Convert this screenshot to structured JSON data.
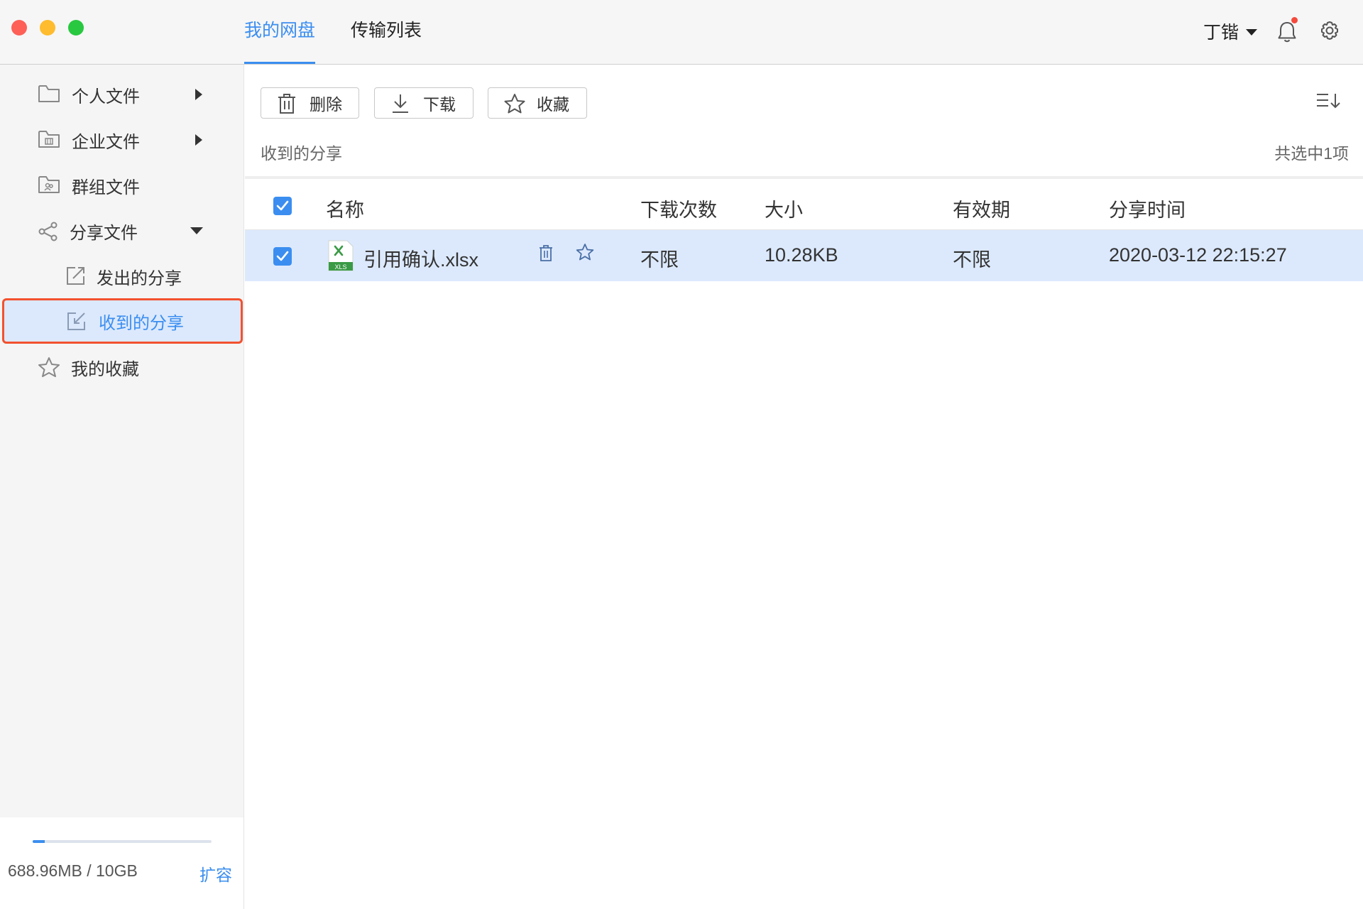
{
  "titlebar": {
    "tabs": [
      {
        "label": "我的网盘",
        "active": true
      },
      {
        "label": "传输列表",
        "active": false
      }
    ],
    "user_name": "丁锴",
    "notification_dot": true,
    "accent_color": "#3b8ef0"
  },
  "sidebar": {
    "items": [
      {
        "label": "个人文件",
        "icon": "folder-icon"
      },
      {
        "label": "企业文件",
        "icon": "enterprise-folder-icon"
      },
      {
        "label": "群组文件",
        "icon": "group-folder-icon"
      },
      {
        "label": "分享文件",
        "icon": "share-icon"
      },
      {
        "label": "发出的分享",
        "icon": "sent-share-icon"
      },
      {
        "label": "收到的分享",
        "icon": "received-share-icon",
        "selected": true
      },
      {
        "label": "我的收藏",
        "icon": "star-icon"
      }
    ],
    "storage": {
      "used_text": "688.96MB / 10GB",
      "used_fraction": 0.067,
      "expand_label": "扩容"
    }
  },
  "toolbar": {
    "delete_label": "删除",
    "download_label": "下载",
    "favorite_label": "收藏"
  },
  "breadcrumb": "收到的分享",
  "selection_count": "共选中1项",
  "table": {
    "headers": [
      "名称",
      "下载次数",
      "大小",
      "有效期",
      "分享时间"
    ],
    "rows": [
      {
        "name": "引用确认.xlsx",
        "file_type_label": "XLS",
        "downloads": "不限",
        "size": "10.28KB",
        "validity": "不限",
        "share_time": "2020-03-12 22:15:27",
        "checked": true
      }
    ]
  }
}
